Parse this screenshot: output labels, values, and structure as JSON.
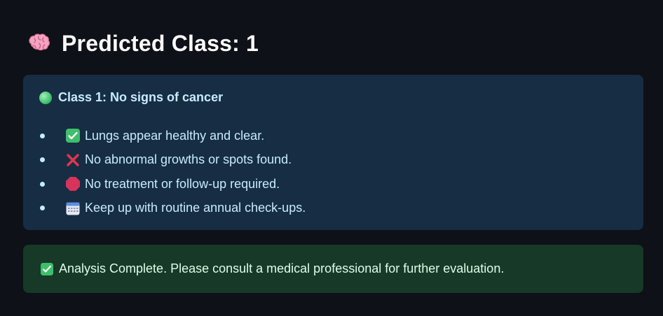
{
  "header": {
    "icon": "brain-icon",
    "title": "Predicted Class: 1"
  },
  "info_box": {
    "heading_icon": "green-circle-icon",
    "heading": "Class 1: No signs of cancer",
    "items": [
      {
        "icon": "check-box-icon",
        "text": "Lungs appear healthy and clear."
      },
      {
        "icon": "cross-mark-icon",
        "text": "No abnormal growths or spots found."
      },
      {
        "icon": "stop-sign-icon",
        "text": "No treatment or follow-up required."
      },
      {
        "icon": "calendar-icon",
        "text": "Keep up with routine annual check-ups."
      }
    ]
  },
  "success_box": {
    "icon": "check-box-icon",
    "text": "Analysis Complete. Please consult a medical professional for further evaluation."
  },
  "colors": {
    "background": "#0e1117",
    "info_bg": "#172d43",
    "info_text": "#c7ebff",
    "success_bg": "#173928",
    "success_text": "#dffde9"
  }
}
